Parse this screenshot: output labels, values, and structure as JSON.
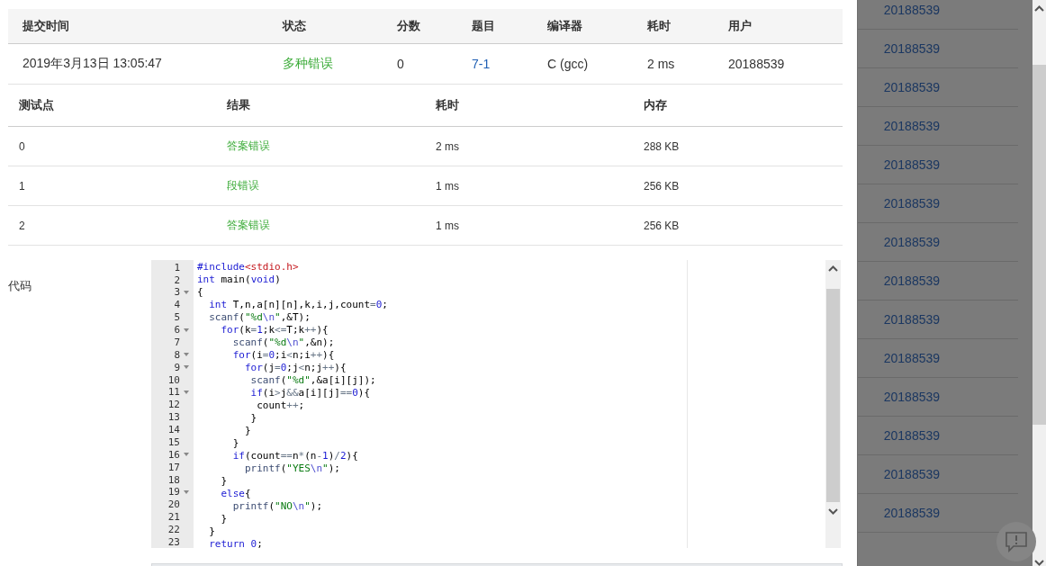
{
  "submission": {
    "columns": [
      "提交时间",
      "状态",
      "分数",
      "题目",
      "编译器",
      "耗时",
      "用户"
    ],
    "rows": [
      {
        "cells": [
          {
            "text": "2019年3月13日 13:05:47",
            "kind": "plain"
          },
          {
            "text": "多种错误",
            "kind": "status"
          },
          {
            "text": "0",
            "kind": "plain"
          },
          {
            "text": "7-1",
            "kind": "link"
          },
          {
            "text": "C (gcc)",
            "kind": "plain"
          },
          {
            "text": "2 ms",
            "kind": "plain"
          },
          {
            "text": "20188539",
            "kind": "plain"
          }
        ]
      }
    ]
  },
  "tests": {
    "columns": [
      "测试点",
      "结果",
      "耗时",
      "内存"
    ],
    "rows": [
      {
        "cells": [
          {
            "text": "0",
            "kind": "plain"
          },
          {
            "text": "答案错误",
            "kind": "status"
          },
          {
            "text": "2 ms",
            "kind": "plain"
          },
          {
            "text": "288 KB",
            "kind": "plain"
          }
        ]
      },
      {
        "cells": [
          {
            "text": "1",
            "kind": "plain"
          },
          {
            "text": "段错误",
            "kind": "status"
          },
          {
            "text": "1 ms",
            "kind": "plain"
          },
          {
            "text": "256 KB",
            "kind": "plain"
          }
        ]
      },
      {
        "cells": [
          {
            "text": "2",
            "kind": "plain"
          },
          {
            "text": "答案错误",
            "kind": "status"
          },
          {
            "text": "1 ms",
            "kind": "plain"
          },
          {
            "text": "256 KB",
            "kind": "plain"
          }
        ]
      }
    ]
  },
  "code": {
    "label": "代码",
    "lines": [
      {
        "n": "1",
        "fold": false,
        "tokens": [
          {
            "text": "#include",
            "kind": "kw"
          },
          {
            "text": "<stdio.h>",
            "kind": "hdr"
          }
        ]
      },
      {
        "n": "2",
        "fold": false,
        "tokens": [
          {
            "text": "int",
            "kind": "kw"
          },
          {
            "text": " main(",
            "kind": "plain"
          },
          {
            "text": "void",
            "kind": "kw"
          },
          {
            "text": ")",
            "kind": "plain"
          }
        ]
      },
      {
        "n": "3",
        "fold": true,
        "tokens": [
          {
            "text": "{",
            "kind": "plain"
          }
        ]
      },
      {
        "n": "4",
        "fold": false,
        "tokens": [
          {
            "text": "  int",
            "kind": "kw"
          },
          {
            "text": " T,n,a[n][n],k,i,j,count",
            "kind": "plain"
          },
          {
            "text": "=",
            "kind": "op"
          },
          {
            "text": "0",
            "kind": "num"
          },
          {
            "text": ";",
            "kind": "plain"
          }
        ]
      },
      {
        "n": "5",
        "fold": false,
        "tokens": [
          {
            "text": "  scanf",
            "kind": "fn"
          },
          {
            "text": "(",
            "kind": "plain"
          },
          {
            "text": "\"%d",
            "kind": "str"
          },
          {
            "text": "\\n",
            "kind": "esc"
          },
          {
            "text": "\"",
            "kind": "str"
          },
          {
            "text": ",&T);",
            "kind": "plain"
          }
        ]
      },
      {
        "n": "6",
        "fold": true,
        "tokens": [
          {
            "text": "    for",
            "kind": "kw"
          },
          {
            "text": "(k",
            "kind": "plain"
          },
          {
            "text": "=",
            "kind": "op"
          },
          {
            "text": "1",
            "kind": "num"
          },
          {
            "text": ";k",
            "kind": "plain"
          },
          {
            "text": "<=",
            "kind": "op"
          },
          {
            "text": "T;k",
            "kind": "plain"
          },
          {
            "text": "++",
            "kind": "op"
          },
          {
            "text": "){",
            "kind": "plain"
          }
        ]
      },
      {
        "n": "7",
        "fold": false,
        "tokens": [
          {
            "text": "      scanf",
            "kind": "fn"
          },
          {
            "text": "(",
            "kind": "plain"
          },
          {
            "text": "\"%d",
            "kind": "str"
          },
          {
            "text": "\\n",
            "kind": "esc"
          },
          {
            "text": "\"",
            "kind": "str"
          },
          {
            "text": ",&n);",
            "kind": "plain"
          }
        ]
      },
      {
        "n": "8",
        "fold": true,
        "tokens": [
          {
            "text": "      for",
            "kind": "kw"
          },
          {
            "text": "(i",
            "kind": "plain"
          },
          {
            "text": "=",
            "kind": "op"
          },
          {
            "text": "0",
            "kind": "num"
          },
          {
            "text": ";i",
            "kind": "plain"
          },
          {
            "text": "<",
            "kind": "op"
          },
          {
            "text": "n;i",
            "kind": "plain"
          },
          {
            "text": "++",
            "kind": "op"
          },
          {
            "text": "){",
            "kind": "plain"
          }
        ]
      },
      {
        "n": "9",
        "fold": true,
        "tokens": [
          {
            "text": "        for",
            "kind": "kw"
          },
          {
            "text": "(j",
            "kind": "plain"
          },
          {
            "text": "=",
            "kind": "op"
          },
          {
            "text": "0",
            "kind": "num"
          },
          {
            "text": ";j",
            "kind": "plain"
          },
          {
            "text": "<",
            "kind": "op"
          },
          {
            "text": "n;j",
            "kind": "plain"
          },
          {
            "text": "++",
            "kind": "op"
          },
          {
            "text": "){",
            "kind": "plain"
          }
        ]
      },
      {
        "n": "10",
        "fold": false,
        "tokens": [
          {
            "text": "         scanf",
            "kind": "fn"
          },
          {
            "text": "(",
            "kind": "plain"
          },
          {
            "text": "\"%d\"",
            "kind": "str"
          },
          {
            "text": ",&a[i][j]);",
            "kind": "plain"
          }
        ]
      },
      {
        "n": "11",
        "fold": true,
        "tokens": [
          {
            "text": "         if",
            "kind": "kw"
          },
          {
            "text": "(i",
            "kind": "plain"
          },
          {
            "text": ">",
            "kind": "op"
          },
          {
            "text": "j",
            "kind": "plain"
          },
          {
            "text": "&&",
            "kind": "op"
          },
          {
            "text": "a[i][j]",
            "kind": "plain"
          },
          {
            "text": "==",
            "kind": "op"
          },
          {
            "text": "0",
            "kind": "num"
          },
          {
            "text": "){",
            "kind": "plain"
          }
        ]
      },
      {
        "n": "12",
        "fold": false,
        "tokens": [
          {
            "text": "          count",
            "kind": "plain"
          },
          {
            "text": "++",
            "kind": "op"
          },
          {
            "text": ";",
            "kind": "plain"
          }
        ]
      },
      {
        "n": "13",
        "fold": false,
        "tokens": [
          {
            "text": "         }",
            "kind": "plain"
          }
        ]
      },
      {
        "n": "14",
        "fold": false,
        "tokens": [
          {
            "text": "        }",
            "kind": "plain"
          }
        ]
      },
      {
        "n": "15",
        "fold": false,
        "tokens": [
          {
            "text": "      }",
            "kind": "plain"
          }
        ]
      },
      {
        "n": "16",
        "fold": true,
        "tokens": [
          {
            "text": "      if",
            "kind": "kw"
          },
          {
            "text": "(count",
            "kind": "plain"
          },
          {
            "text": "==",
            "kind": "op"
          },
          {
            "text": "n",
            "kind": "plain"
          },
          {
            "text": "*",
            "kind": "op"
          },
          {
            "text": "(n",
            "kind": "plain"
          },
          {
            "text": "-",
            "kind": "op"
          },
          {
            "text": "1",
            "kind": "num"
          },
          {
            "text": ")",
            "kind": "plain"
          },
          {
            "text": "/",
            "kind": "op"
          },
          {
            "text": "2",
            "kind": "num"
          },
          {
            "text": "){",
            "kind": "plain"
          }
        ]
      },
      {
        "n": "17",
        "fold": false,
        "tokens": [
          {
            "text": "        printf",
            "kind": "fn"
          },
          {
            "text": "(",
            "kind": "plain"
          },
          {
            "text": "\"YES",
            "kind": "str"
          },
          {
            "text": "\\n",
            "kind": "esc"
          },
          {
            "text": "\"",
            "kind": "str"
          },
          {
            "text": ");",
            "kind": "plain"
          }
        ]
      },
      {
        "n": "18",
        "fold": false,
        "tokens": [
          {
            "text": "    }",
            "kind": "plain"
          }
        ]
      },
      {
        "n": "19",
        "fold": true,
        "tokens": [
          {
            "text": "    else",
            "kind": "kw"
          },
          {
            "text": "{",
            "kind": "plain"
          }
        ]
      },
      {
        "n": "20",
        "fold": false,
        "tokens": [
          {
            "text": "      printf",
            "kind": "fn"
          },
          {
            "text": "(",
            "kind": "plain"
          },
          {
            "text": "\"NO",
            "kind": "str"
          },
          {
            "text": "\\n",
            "kind": "esc"
          },
          {
            "text": "\"",
            "kind": "str"
          },
          {
            "text": ");",
            "kind": "plain"
          }
        ]
      },
      {
        "n": "21",
        "fold": false,
        "tokens": [
          {
            "text": "    }",
            "kind": "plain"
          }
        ]
      },
      {
        "n": "22",
        "fold": false,
        "tokens": [
          {
            "text": "  }",
            "kind": "plain"
          }
        ]
      },
      {
        "n": "23",
        "fold": false,
        "tokens": [
          {
            "text": "  return",
            "kind": "kw"
          },
          {
            "text": " 0",
            "kind": "num"
          },
          {
            "text": ";",
            "kind": "plain"
          }
        ]
      }
    ]
  },
  "side_list": [
    "20188539",
    "20188539",
    "20188539",
    "20188539",
    "20188539",
    "20188539",
    "20188539",
    "20188539",
    "20188539",
    "20188539",
    "20188539",
    "20188539",
    "20188539",
    "20188539"
  ]
}
